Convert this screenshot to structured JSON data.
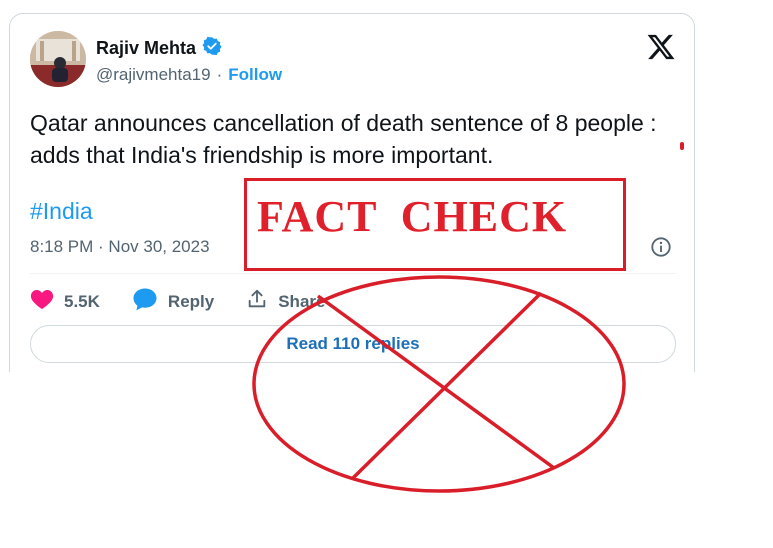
{
  "tweet": {
    "author_name": "Rajiv Mehta",
    "handle": "@rajivmehta19",
    "separator": "·",
    "follow_label": "Follow",
    "text": "Qatar announces cancellation of death sentence of 8 people : adds that India's friendship is more important.",
    "hashtag": "#India",
    "timestamp": "8:18 PM · Nov 30, 2023",
    "likes": "5.5K",
    "reply_label": "Reply",
    "share_label": "Share",
    "read_replies_label": "Read 110 replies"
  },
  "overlay": {
    "stamp_text": "FACT  CHECK"
  },
  "colors": {
    "accent_blue": "#1d9bf0",
    "verified_blue": "#1d9bf0",
    "like_pink": "#f91880",
    "stamp_red": "#d91e2a"
  },
  "icons": {
    "platform": "x-logo-icon",
    "verified": "verified-badge-icon",
    "info": "info-icon",
    "like": "heart-icon",
    "reply": "reply-bubble-icon",
    "share": "share-icon"
  }
}
